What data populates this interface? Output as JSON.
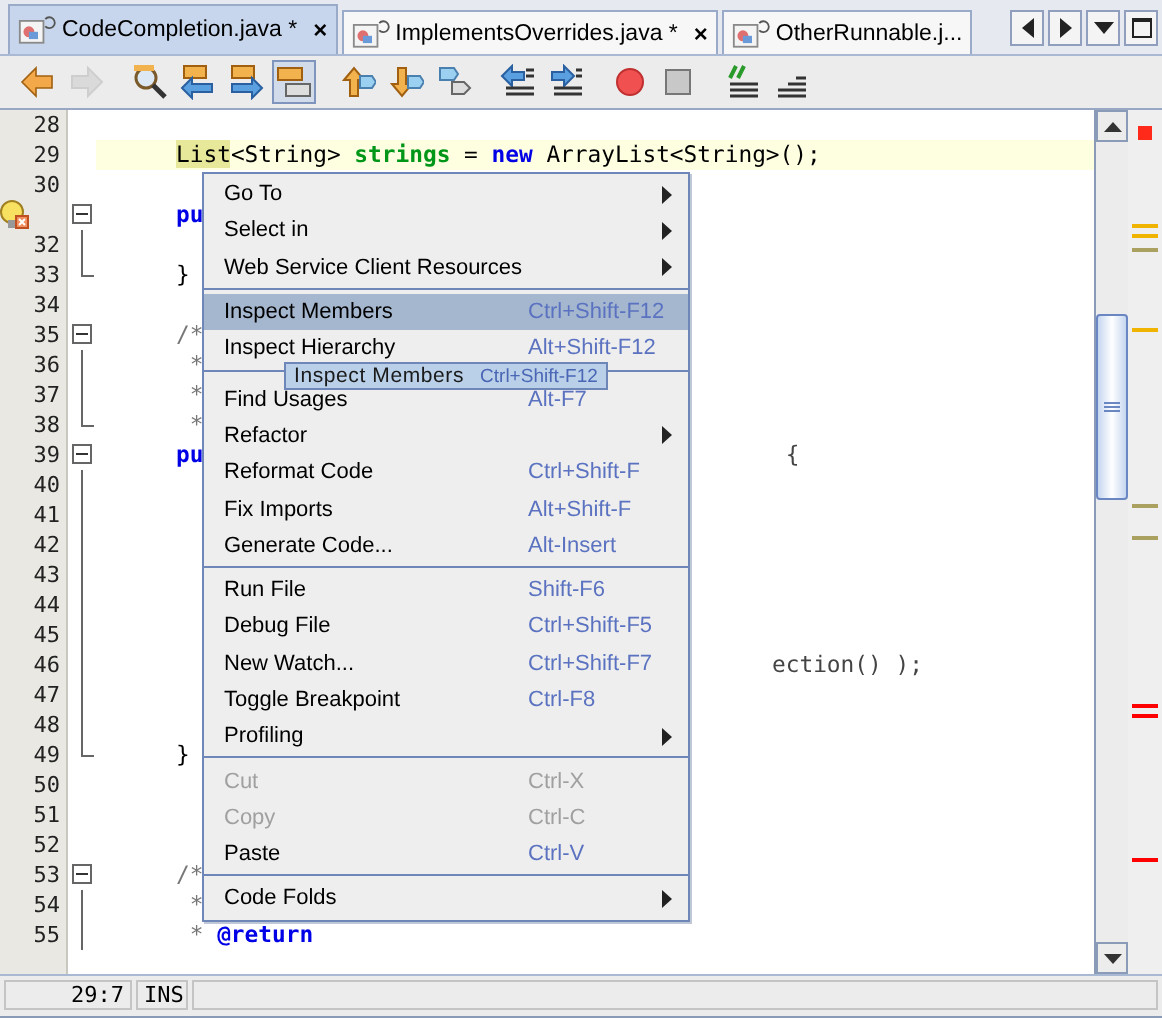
{
  "tabs": [
    {
      "label": "CodeCompletion.java *",
      "selected": true,
      "close": "×"
    },
    {
      "label": "ImplementsOverrides.java *",
      "selected": false,
      "close": "×"
    },
    {
      "label": "OtherRunnable.j...",
      "selected": false
    }
  ],
  "tab_controls": [
    {
      "kind": "left"
    },
    {
      "kind": "right"
    },
    {
      "kind": "dropdown"
    },
    {
      "kind": "maximize"
    }
  ],
  "toolbar": {
    "groups": [
      [
        {
          "kind": "back",
          "disabled": false,
          "pressed": false
        },
        {
          "kind": "forward",
          "disabled": true,
          "pressed": false
        }
      ],
      [
        {
          "kind": "find",
          "disabled": false,
          "pressed": false
        },
        {
          "kind": "find-prev",
          "disabled": false,
          "pressed": false
        },
        {
          "kind": "find-next",
          "disabled": false,
          "pressed": false
        },
        {
          "kind": "highlight",
          "disabled": false,
          "pressed": true
        }
      ],
      [
        {
          "kind": "prev-bookmark",
          "disabled": false,
          "pressed": false
        },
        {
          "kind": "next-bookmark",
          "disabled": false,
          "pressed": false
        },
        {
          "kind": "toggle-bookmark",
          "disabled": false,
          "pressed": false
        }
      ],
      [
        {
          "kind": "shift-left",
          "disabled": false,
          "pressed": false
        },
        {
          "kind": "shift-right",
          "disabled": false,
          "pressed": false
        }
      ],
      [
        {
          "kind": "record",
          "disabled": false,
          "pressed": false
        },
        {
          "kind": "stop",
          "disabled": false,
          "pressed": false
        }
      ],
      [
        {
          "kind": "comment",
          "disabled": false,
          "pressed": false
        },
        {
          "kind": "uncomment",
          "disabled": false,
          "pressed": false
        }
      ]
    ]
  },
  "editor": {
    "lines": [
      {
        "number": "28",
        "kind": "plain"
      },
      {
        "number": "29",
        "kind": "plain",
        "current": true,
        "segments": [
          {
            "text": "List",
            "kind": "marked"
          },
          {
            "text": "<String> ",
            "kind": "plain"
          },
          {
            "text": "strings",
            "kind": "field"
          },
          {
            "text": " = ",
            "kind": "plain"
          },
          {
            "text": "new",
            "kind": "keyword"
          },
          {
            "text": " ArrayList<String>();",
            "kind": "plain"
          }
        ]
      },
      {
        "number": "30",
        "kind": "plain"
      },
      {
        "kind": "fold-start",
        "hint": true,
        "segments": [
          {
            "text": "pu",
            "kind": "keyword"
          }
        ]
      },
      {
        "number": "32",
        "kind": "fold-body"
      },
      {
        "number": "33",
        "kind": "fold-end",
        "segments": [
          {
            "text": "}",
            "kind": "plain"
          }
        ]
      },
      {
        "number": "34",
        "kind": "plain"
      },
      {
        "number": "35",
        "kind": "fold-start",
        "segments": [
          {
            "text": "/*",
            "kind": "comment"
          }
        ]
      },
      {
        "number": "36",
        "kind": "fold-body",
        "segments": [
          {
            "text": " *",
            "kind": "comment"
          }
        ]
      },
      {
        "number": "37",
        "kind": "fold-body",
        "segments": [
          {
            "text": " *",
            "kind": "comment"
          }
        ]
      },
      {
        "number": "38",
        "kind": "fold-end",
        "segments": [
          {
            "text": " *",
            "kind": "comment"
          }
        ]
      },
      {
        "number": "39",
        "kind": "fold-start",
        "segments": [
          {
            "text": "pu",
            "kind": "keyword"
          }
        ],
        "tail": " {"
      },
      {
        "number": "40",
        "kind": "fold-body"
      },
      {
        "number": "41",
        "kind": "fold-body"
      },
      {
        "number": "42",
        "kind": "fold-body"
      },
      {
        "number": "43",
        "kind": "fold-body"
      },
      {
        "number": "44",
        "kind": "fold-body"
      },
      {
        "number": "45",
        "kind": "fold-body"
      },
      {
        "number": "46",
        "kind": "fold-body",
        "tail": "ection() );"
      },
      {
        "number": "47",
        "kind": "fold-body"
      },
      {
        "number": "48",
        "kind": "fold-body"
      },
      {
        "number": "49",
        "kind": "fold-end",
        "segments": [
          {
            "text": "}",
            "kind": "plain"
          }
        ]
      },
      {
        "number": "50",
        "kind": "plain"
      },
      {
        "number": "51",
        "kind": "plain"
      },
      {
        "number": "52",
        "kind": "plain"
      },
      {
        "number": "53",
        "kind": "fold-start",
        "segments": [
          {
            "text": "/*",
            "kind": "comment"
          }
        ]
      },
      {
        "number": "54",
        "kind": "fold-body",
        "segments": [
          {
            "text": " *",
            "kind": "comment"
          }
        ]
      },
      {
        "number": "55",
        "kind": "fold-body",
        "segments": [
          {
            "text": " * ",
            "kind": "comment"
          },
          {
            "text": "@return",
            "kind": "tag"
          }
        ]
      }
    ]
  },
  "context_menu": {
    "sections": [
      [
        {
          "label": "Go To",
          "submenu": true,
          "selected": false,
          "disabled": false
        },
        {
          "label": "Select in",
          "submenu": true,
          "selected": false,
          "disabled": false
        },
        {
          "label": "Web Service Client Resources",
          "submenu": true,
          "selected": false,
          "disabled": false
        }
      ],
      [
        {
          "label": "Inspect Members",
          "shortcut": "Ctrl+Shift-F12",
          "selected": true,
          "disabled": false
        },
        {
          "label": "Inspect Hierarchy",
          "shortcut": "Alt+Shift-F12",
          "selected": false,
          "disabled": false
        }
      ],
      [
        {
          "label": "Find Usages",
          "shortcut": "Alt-F7",
          "selected": false,
          "disabled": false
        },
        {
          "label": "Refactor",
          "submenu": true,
          "selected": false,
          "disabled": false
        },
        {
          "label": "Reformat Code",
          "shortcut": "Ctrl+Shift-F",
          "selected": false,
          "disabled": false
        },
        {
          "label": "Fix Imports",
          "shortcut": "Alt+Shift-F",
          "selected": false,
          "disabled": false
        },
        {
          "label": "Generate Code...",
          "shortcut": "Alt-Insert",
          "selected": false,
          "disabled": false
        }
      ],
      [
        {
          "label": "Run File",
          "shortcut": "Shift-F6",
          "selected": false,
          "disabled": false
        },
        {
          "label": "Debug File",
          "shortcut": "Ctrl+Shift-F5",
          "selected": false,
          "disabled": false
        },
        {
          "label": "New Watch...",
          "shortcut": "Ctrl+Shift-F7",
          "selected": false,
          "disabled": false
        },
        {
          "label": "Toggle Breakpoint",
          "shortcut": "Ctrl-F8",
          "selected": false,
          "disabled": false
        },
        {
          "label": "Profiling",
          "submenu": true,
          "selected": false,
          "disabled": false
        }
      ],
      [
        {
          "label": "Cut",
          "shortcut": "Ctrl-X",
          "selected": false,
          "disabled": true
        },
        {
          "label": "Copy",
          "shortcut": "Ctrl-C",
          "selected": false,
          "disabled": true
        },
        {
          "label": "Paste",
          "shortcut": "Ctrl-V",
          "selected": false,
          "disabled": false
        }
      ],
      [
        {
          "label": "Code Folds",
          "submenu": true,
          "selected": false,
          "disabled": false
        }
      ]
    ]
  },
  "tooltip": {
    "label": "Inspect Members",
    "shortcut": "Ctrl+Shift-F12"
  },
  "status_bar": {
    "position": "29:7",
    "mode": "INS"
  }
}
